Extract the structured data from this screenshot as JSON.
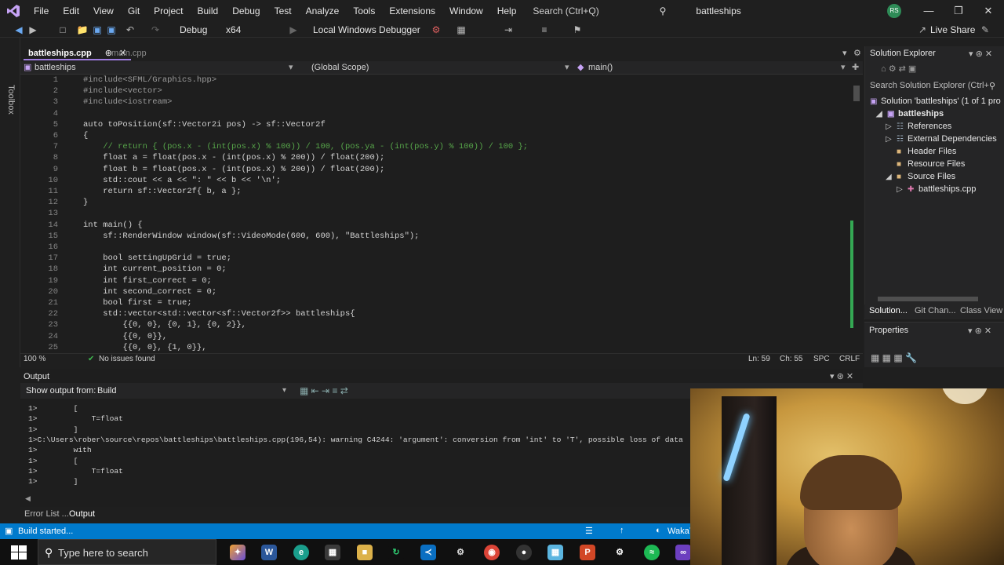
{
  "menu": [
    "File",
    "Edit",
    "View",
    "Git",
    "Project",
    "Build",
    "Debug",
    "Test",
    "Analyze",
    "Tools",
    "Extensions",
    "Window",
    "Help"
  ],
  "search": {
    "placeholder": "Search (Ctrl+Q)"
  },
  "solution_name": "battleships",
  "avatar_initials": "RS",
  "toolbar": {
    "config": "Debug",
    "platform": "x64",
    "debugger": "Local Windows Debugger",
    "live_share": "Live Share"
  },
  "toolbox_label": "Toolbox",
  "tabs": {
    "active": "battleships.cpp",
    "inactive": "main.cpp"
  },
  "nav": {
    "project": "battleships",
    "scope": "(Global Scope)",
    "member": "main()"
  },
  "code": [
    {
      "n": "1",
      "t": "#include<SFML/Graphics.hpp>"
    },
    {
      "n": "2",
      "t": "#include<vector>"
    },
    {
      "n": "3",
      "t": "#include<iostream>"
    },
    {
      "n": "4",
      "t": ""
    },
    {
      "n": "5",
      "t": "auto toPosition(sf::Vector2i pos) -> sf::Vector2f"
    },
    {
      "n": "6",
      "t": "{"
    },
    {
      "n": "7",
      "t": "    // return { (pos.x - (int(pos.x) % 100)) / 100, (pos.ya - (int(pos.y) % 100)) / 100 };"
    },
    {
      "n": "8",
      "t": "    float a = float(pos.x - (int(pos.x) % 200)) / float(200);"
    },
    {
      "n": "9",
      "t": "    float b = float(pos.x - (int(pos.x) % 200)) / float(200);"
    },
    {
      "n": "10",
      "t": "    std::cout << a << \": \" << b << '\\n';"
    },
    {
      "n": "11",
      "t": "    return sf::Vector2f{ b, a };"
    },
    {
      "n": "12",
      "t": "}"
    },
    {
      "n": "13",
      "t": ""
    },
    {
      "n": "14",
      "t": "int main() {"
    },
    {
      "n": "15",
      "t": "    sf::RenderWindow window(sf::VideoMode(600, 600), \"Battleships\");"
    },
    {
      "n": "16",
      "t": ""
    },
    {
      "n": "17",
      "t": "    bool settingUpGrid = true;"
    },
    {
      "n": "18",
      "t": "    int current_position = 0;"
    },
    {
      "n": "19",
      "t": "    int first_correct = 0;"
    },
    {
      "n": "20",
      "t": "    int second_correct = 0;"
    },
    {
      "n": "21",
      "t": "    bool first = true;"
    },
    {
      "n": "22",
      "t": "    std::vector<std::vector<sf::Vector2f>> battleships{"
    },
    {
      "n": "23",
      "t": "        {{0, 0}, {0, 1}, {0, 2}},"
    },
    {
      "n": "24",
      "t": "        {{0, 0}},"
    },
    {
      "n": "25",
      "t": "        {{0, 0}, {1, 0}},"
    }
  ],
  "editor_status": {
    "zoom": "100 %",
    "issues": "No issues found",
    "ln": "Ln: 59",
    "ch": "Ch: 55",
    "spc": "SPC",
    "crlf": "CRLF"
  },
  "solution_explorer": {
    "title": "Solution Explorer",
    "search_placeholder": "Search Solution Explorer (Ctrl+",
    "solution": "Solution 'battleships' (1 of 1 pro",
    "project": "battleships",
    "items": [
      "References",
      "External Dependencies",
      "Header Files",
      "Resource Files",
      "Source Files"
    ],
    "file": "battleships.cpp"
  },
  "sol_tabs": [
    "Solution...",
    "Git Chan...",
    "Class View"
  ],
  "properties_title": "Properties",
  "output": {
    "title": "Output",
    "show_from_label": "Show output from:",
    "source": "Build",
    "lines": [
      "1>        [",
      "1>            T=float",
      "1>        ]",
      "1>C:\\Users\\rober\\source\\repos\\battleships\\battleships.cpp(196,54): warning C4244: 'argument': conversion from 'int' to 'T', possible loss of data",
      "1>        with",
      "1>        [",
      "1>            T=float",
      "1>        ]"
    ]
  },
  "bottom_tabs": [
    "Error List ...",
    "Output"
  ],
  "statusbar": {
    "text": "Build started...",
    "right": "WakaT"
  },
  "taskbar": {
    "search_placeholder": "Type here to search"
  }
}
